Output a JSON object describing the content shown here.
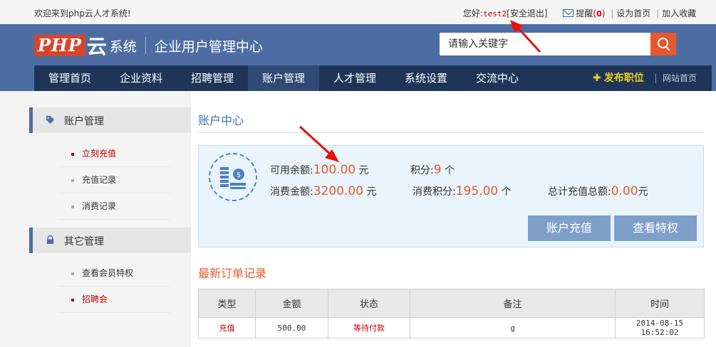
{
  "topbar": {
    "welcome": "欢迎来到php云人才系统!",
    "greeting": "您好:",
    "username": "test2",
    "logout": "[安全退出]",
    "remind": "提醒",
    "remind_count_open": "(",
    "remind_count": "0",
    "remind_count_close": ")",
    "set_home": "设为首页",
    "favorite": "加入收藏"
  },
  "header": {
    "logo_php": "PHP",
    "logo_yun": "云",
    "logo_sys": "系统",
    "title": "企业用户管理中心",
    "search_placeholder": "请输入关键字"
  },
  "nav": {
    "items": [
      {
        "label": "管理首页"
      },
      {
        "label": "企业资料"
      },
      {
        "label": "招聘管理"
      },
      {
        "label": "账户管理",
        "active": true
      },
      {
        "label": "人才管理"
      },
      {
        "label": "系统设置"
      },
      {
        "label": "交流中心"
      }
    ],
    "publish": "发布职位",
    "site_home": "网站首页"
  },
  "sidebar": {
    "section1": {
      "title": "账户管理",
      "items": [
        {
          "label": "立刻充值",
          "highlight": true
        },
        {
          "label": "充值记录"
        },
        {
          "label": "消费记录"
        }
      ]
    },
    "section2": {
      "title": "其它管理",
      "items": [
        {
          "label": "查看会员特权"
        },
        {
          "label": "招聘会",
          "highlight": true
        }
      ]
    }
  },
  "account": {
    "title": "账户中心",
    "balance_label": "可用余额:",
    "balance_value": "100.00",
    "balance_unit": "元",
    "points_label": "积分:",
    "points_value": "9",
    "points_unit": "个",
    "spent_label": "消费金额:",
    "spent_value": "3200.00",
    "spent_unit": "元",
    "spent_points_label": "消费积分:",
    "spent_points_value": "195.00",
    "spent_points_unit": "个",
    "total_recharge_label": "总计充值总额:",
    "total_recharge_value": "0.00",
    "total_recharge_unit": "元",
    "recharge_button": "账户充值",
    "privilege_button": "查看特权"
  },
  "orders": {
    "title": "最新订单记录",
    "columns": [
      "类型",
      "金额",
      "状态",
      "备注",
      "时间"
    ],
    "rows": [
      {
        "type": "充值",
        "amount": "500.00",
        "status": "等待付款",
        "note": "g",
        "time": "2014-08-15 16:52:02"
      }
    ]
  },
  "colors": {
    "header_blue": "#4e6ea3",
    "nav_dark": "#1e3559",
    "accent_orange": "#e8582d",
    "link_red": "#c00000",
    "button_blue": "#7f9fcb"
  }
}
